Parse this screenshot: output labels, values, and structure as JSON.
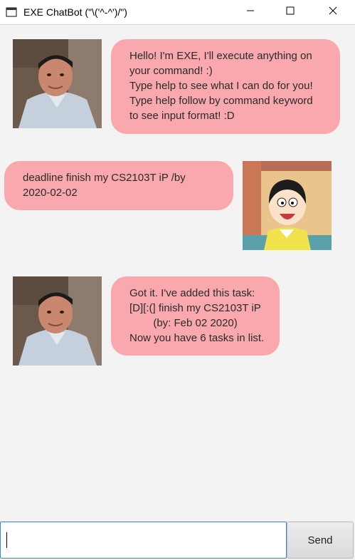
{
  "window": {
    "title": "EXE ChatBot (\"\\('^-^')/\")"
  },
  "messages": [
    {
      "sender": "bot",
      "avatar_icon": "man-photo-avatar",
      "lines": [
        "Hello! I'm EXE, I'll execute anything on",
        "your command! :)",
        "Type help to see what I can do for you!",
        "Type help follow by command keyword",
        "to see input format! :D"
      ]
    },
    {
      "sender": "user",
      "avatar_icon": "cartoon-boy-avatar",
      "lines": [
        "deadline finish my CS2103T iP /by",
        "2020-02-02"
      ]
    },
    {
      "sender": "bot",
      "avatar_icon": "man-photo-avatar",
      "lines": [
        "Got it. I've added this task:",
        "[D][:(] finish my CS2103T iP",
        "        (by: Feb 02 2020)",
        "Now you have 6 tasks in list."
      ]
    }
  ],
  "input": {
    "value": "",
    "send_label": "Send"
  },
  "colors": {
    "bubble": "#f9a9ad",
    "chat_background": "#f3f3f3",
    "input_focus_border": "#3a84d8"
  }
}
